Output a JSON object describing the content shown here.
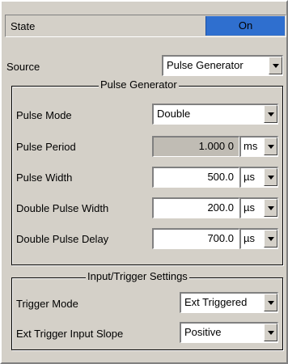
{
  "state": {
    "label": "State",
    "value": "On"
  },
  "source": {
    "label": "Source",
    "value": "Pulse Generator"
  },
  "pulse_generator": {
    "title": "Pulse Generator",
    "pulse_mode": {
      "label": "Pulse Mode",
      "value": "Double"
    },
    "pulse_period": {
      "label": "Pulse Period",
      "value": "1.000 0",
      "unit": "ms"
    },
    "pulse_width": {
      "label": "Pulse Width",
      "value": "500.0",
      "unit": "µs"
    },
    "double_pulse_width": {
      "label": "Double Pulse Width",
      "value": "200.0",
      "unit": "µs"
    },
    "double_pulse_delay": {
      "label": "Double Pulse Delay",
      "value": "700.0",
      "unit": "µs"
    }
  },
  "trigger": {
    "title": "Input/Trigger Settings",
    "trigger_mode": {
      "label": "Trigger Mode",
      "value": "Ext Triggered"
    },
    "slope": {
      "label": "Ext Trigger Input Slope",
      "value": "Positive"
    }
  },
  "colors": {
    "state_on_bg": "#2f6fcf",
    "panel_bg": "#d4d0c8"
  },
  "icons": {
    "dropdown": "chevron-down-icon"
  }
}
